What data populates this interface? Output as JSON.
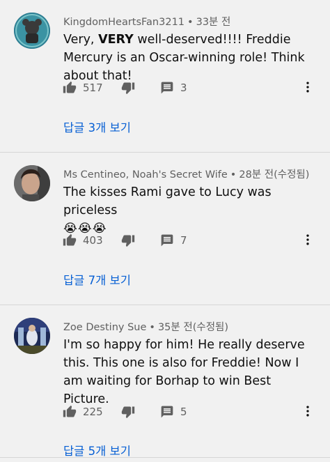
{
  "comments": [
    {
      "author": "KingdomHeartsFan3211",
      "time": "33분 전",
      "text_before": "Very, ",
      "text_bold": "VERY",
      "text_after": " well-deserved!!!! Freddie Mercury is an Oscar-winning role! Think about that!",
      "emoji": "",
      "likes": "517",
      "reply_count": "3",
      "view_replies": "답글 3개 보기"
    },
    {
      "author": "Ms Centineo, Noah's Secret Wife",
      "time": "28분 전(수정됨)",
      "text_before": "The kisses Rami gave to Lucy was priceless",
      "text_bold": "",
      "text_after": "",
      "emoji": "😭😭😭",
      "likes": "403",
      "reply_count": "7",
      "view_replies": "답글 7개 보기"
    },
    {
      "author": "Zoe Destiny Sue",
      "time": "35분 전(수정됨)",
      "text_before": "I'm so happy for him! He really deserve this. This one is also for Freddie! Now I am waiting for Borhap to win Best Picture.",
      "text_bold": "",
      "text_after": "",
      "emoji": "",
      "likes": "225",
      "reply_count": "5",
      "view_replies": "답글 5개 보기"
    }
  ],
  "icons": {
    "like": "thumbs-up-icon",
    "dislike": "thumbs-down-icon",
    "reply": "reply-icon",
    "more": "more-vert-icon"
  },
  "colors": {
    "link": "#065fd4",
    "meta": "#606060",
    "background": "#f1f1f1"
  }
}
